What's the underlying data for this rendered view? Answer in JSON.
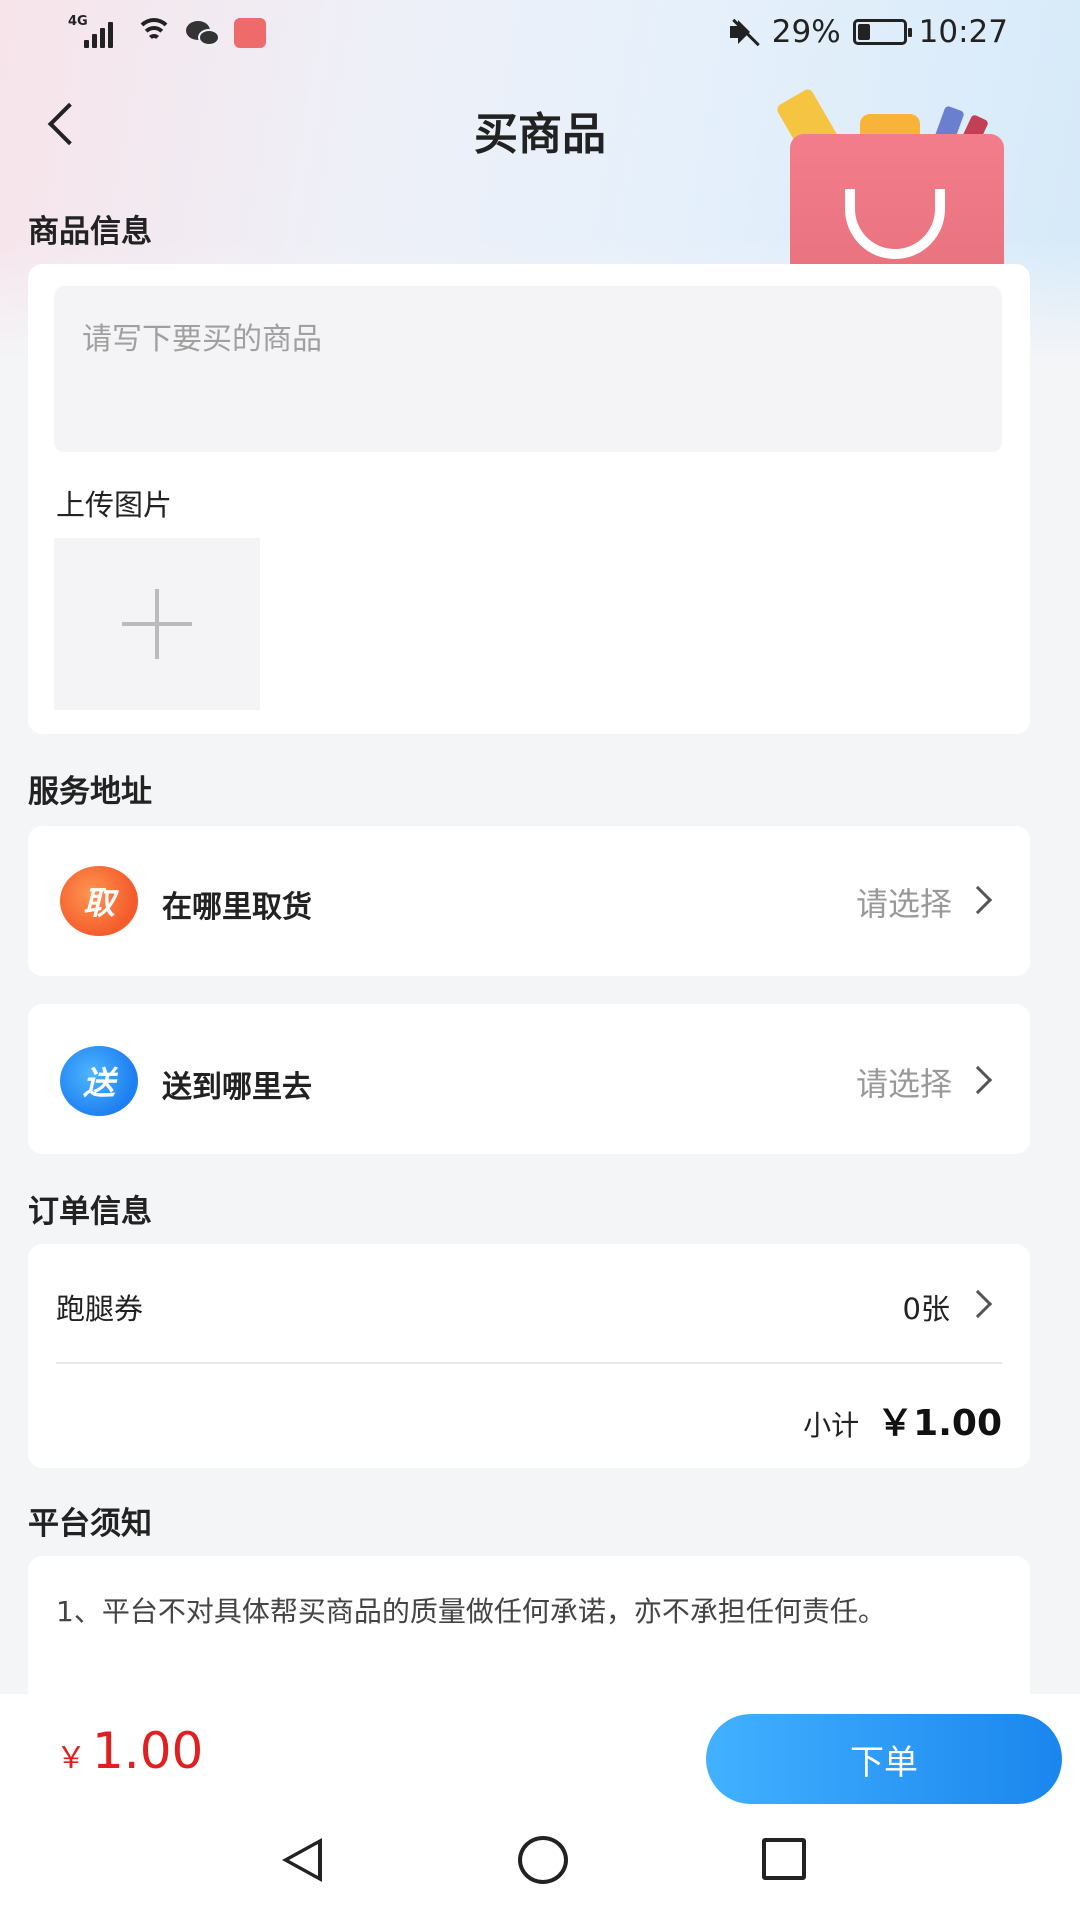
{
  "status_bar": {
    "network": "4G",
    "battery": "29%",
    "battery_level": 0.29,
    "time": "10:27"
  },
  "header": {
    "title": "买商品",
    "back_icon": "chevron-left-icon"
  },
  "goods_section": {
    "title": "商品信息",
    "input_placeholder": "请写下要买的商品",
    "upload_label": "上传图片"
  },
  "address_section": {
    "title": "服务地址",
    "pickup": {
      "badge": "取",
      "label": "在哪里取货",
      "value": "请选择"
    },
    "delivery": {
      "badge": "送",
      "label": "送到哪里去",
      "value": "请选择"
    }
  },
  "order_section": {
    "title": "订单信息",
    "coupon_label": "跑腿券",
    "coupon_value": "0张",
    "subtotal_label": "小计",
    "subtotal_value": "￥1.00"
  },
  "notice_section": {
    "title": "平台须知",
    "text": "1、平台不对具体帮买商品的质量做任何承诺，亦不承担任何责任。"
  },
  "bottom_bar": {
    "price_symbol": "￥",
    "price": "1.00",
    "order_button": "下单"
  },
  "colors": {
    "accent_blue": "#1a86ee",
    "price_red": "#e02020",
    "pickup_orange": "#f45a2b"
  }
}
